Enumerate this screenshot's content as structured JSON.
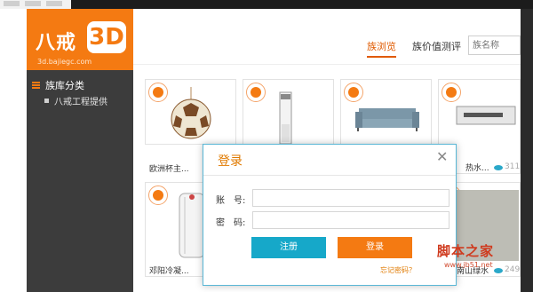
{
  "logo": {
    "brand": "八戒",
    "mark": "3D",
    "url": "3d.bajiegc.com"
  },
  "sidebar": {
    "heading": "族库分类",
    "items": [
      {
        "label": "八戒工程提供"
      }
    ]
  },
  "nav": {
    "tabs": [
      {
        "label": "族浏览",
        "active": true
      },
      {
        "label": "族价值测评",
        "active": false
      }
    ],
    "search_placeholder": "族名称"
  },
  "cards": [
    {
      "name": "欧洲杯主...",
      "count": ""
    },
    {
      "name": "",
      "count": ""
    },
    {
      "name": "",
      "count": ""
    },
    {
      "name": "热水...",
      "count": "311"
    },
    {
      "name": "邓阳冷凝...",
      "count": ""
    },
    {
      "name": "南山绿水",
      "count": "249"
    }
  ],
  "dialog": {
    "title": "登录",
    "account_label": "账　号:",
    "password_label": "密　码:",
    "register_label": "注册",
    "login_label": "登录",
    "forgot_label": "忘记密码？"
  },
  "watermark": {
    "title": "脚本之家",
    "url": "www.jb51.net"
  },
  "colors": {
    "accent": "#f47a12",
    "blue": "#16a8c9",
    "sidebar": "#3c3c3c"
  }
}
